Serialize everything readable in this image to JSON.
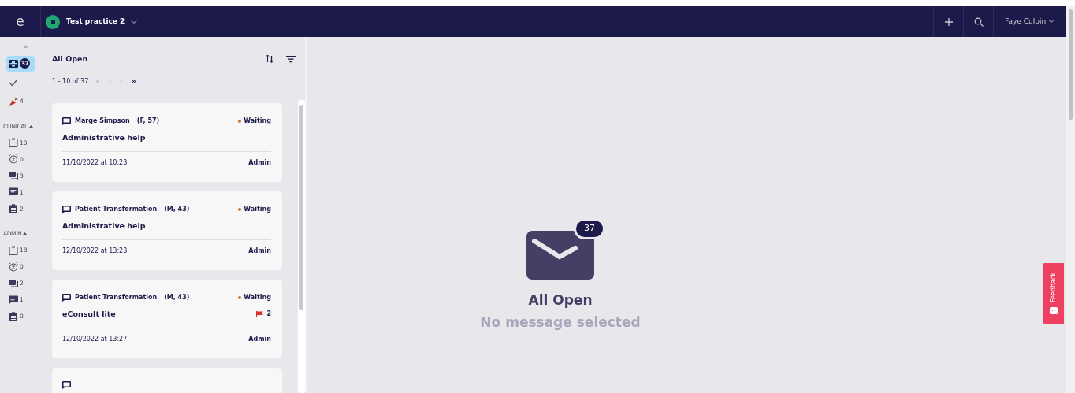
{
  "topbar": {
    "logo": "e",
    "practice": "Test practice 2",
    "user": "Faye Culpin"
  },
  "sidebar": {
    "expand": "»",
    "items": [
      {
        "kind": "inbox",
        "count": "37",
        "selected": true
      },
      {
        "kind": "check",
        "selected": false
      },
      {
        "kind": "unassigned",
        "count": "4",
        "selected": false
      }
    ],
    "sections": [
      {
        "title": "CLINICAL",
        "items": [
          {
            "kind": "clipboard",
            "count": "10"
          },
          {
            "kind": "snooze",
            "count": "0"
          },
          {
            "kind": "chats",
            "count": "3"
          },
          {
            "kind": "message",
            "count": "1"
          },
          {
            "kind": "list",
            "count": "2"
          }
        ]
      },
      {
        "title": "ADMIN",
        "items": [
          {
            "kind": "clipboard",
            "count": "18"
          },
          {
            "kind": "snooze",
            "count": "0"
          },
          {
            "kind": "chats",
            "count": "2"
          },
          {
            "kind": "message",
            "count": "1"
          },
          {
            "kind": "list",
            "count": "0"
          }
        ]
      }
    ]
  },
  "list": {
    "title": "All Open",
    "range": "1 - 10 of 37",
    "pager": [
      {
        "label": "«",
        "disabled": true
      },
      {
        "label": "‹",
        "disabled": true
      },
      {
        "label": "›",
        "disabled": true
      },
      {
        "label": "»",
        "disabled": false
      }
    ],
    "cards": [
      {
        "patient": "Marge Simpson",
        "details": "(F, 57)",
        "status": "Waiting",
        "subject": "Administrative help",
        "date": "11/10/2022 at 10:23",
        "assignee": "Admin"
      },
      {
        "patient": "Patient Transformation",
        "details": "(M, 43)",
        "status": "Waiting",
        "subject": "Administrative help",
        "date": "12/10/2022 at 13:23",
        "assignee": "Admin"
      },
      {
        "patient": "Patient Transformation",
        "details": "(M, 43)",
        "status": "Waiting",
        "subject": "eConsult lite",
        "flags": "2",
        "date": "12/10/2022 at 13:27",
        "assignee": "Admin"
      },
      {
        "kind": "message"
      }
    ]
  },
  "empty_state": {
    "count": "37",
    "title": "All Open",
    "subtitle": "No message selected"
  },
  "feedback": "Feedback"
}
